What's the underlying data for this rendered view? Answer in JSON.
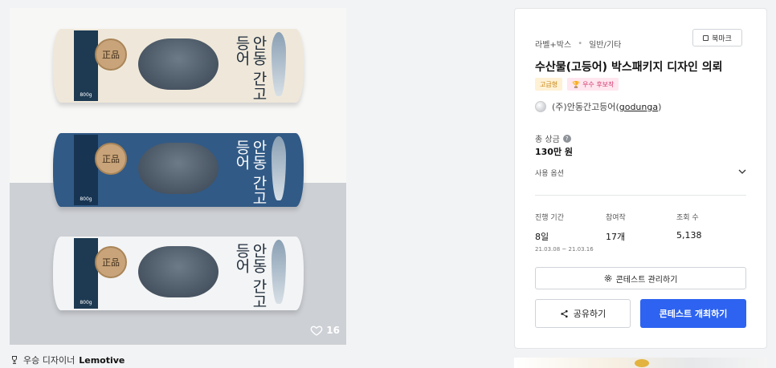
{
  "gallery": {
    "like_count": "16",
    "packs": [
      {
        "seal": "正品",
        "title": "안동 간고등어",
        "weight": "800g"
      },
      {
        "seal": "正品",
        "title": "안동 간고등어",
        "weight": "800g"
      },
      {
        "seal": "正品",
        "title": "안동 간고등어",
        "weight": "800g"
      }
    ]
  },
  "designer": {
    "prefix": "우승 디자이너",
    "name": "Lemotive"
  },
  "panel": {
    "category_1": "라벨+박스",
    "category_2": "일반/기타",
    "bookmark_label": "북마크",
    "title": "수산물(고등어) 박스패키지 디자인 의뢰",
    "badge_gold": "고급형",
    "badge_award": "우수 후보작",
    "company_name": "(주)안동간고등어",
    "company_id": "godunga",
    "prize_label": "총 상금",
    "prize_value": "130만 원",
    "options_label": "사용 옵션",
    "stats": {
      "period_label": "진행 기간",
      "period_value": "8일",
      "period_range": "21.03.08 ~ 21.03.16",
      "entries_label": "참여작",
      "entries_value": "17개",
      "views_label": "조회 수",
      "views_value": "5,138"
    },
    "manage_label": "콘테스트 관리하기",
    "share_label": "공유하기",
    "host_label": "콘테스트 개최하기"
  }
}
